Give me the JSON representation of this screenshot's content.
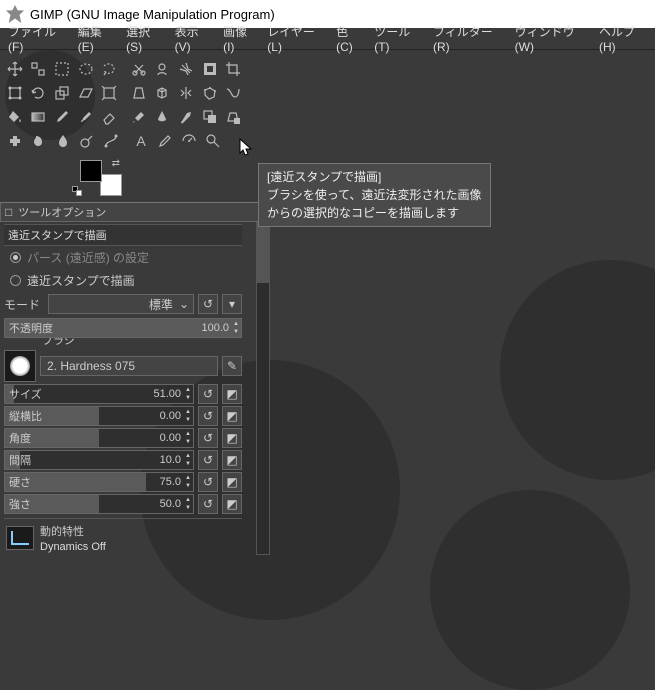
{
  "window": {
    "title": "GIMP (GNU Image Manipulation Program)"
  },
  "menu": {
    "file": "ファイル(F)",
    "edit": "編集(E)",
    "select": "選択(S)",
    "view": "表示(V)",
    "image": "画像(I)",
    "layer": "レイヤー(L)",
    "color": "色(C)",
    "tools": "ツール(T)",
    "filter": "フィルター(R)",
    "window": "ウィンドウ(W)",
    "help": "ヘルプ(H)"
  },
  "dock": {
    "title_icon": "□",
    "title": "ツールオプション",
    "menu_btn": "◂"
  },
  "options": {
    "title": "遠近スタンプで描画",
    "radio1": "パース (遠近感) の設定",
    "radio2": "遠近スタンプで描画",
    "mode_label": "モード",
    "mode_value": "標準",
    "opacity_label": "不透明度",
    "opacity_value": "100.0",
    "brush_label": "ブラシ",
    "brush_name": "2. Hardness 075",
    "size_label": "サイズ",
    "size_value": "51.00",
    "aspect_label": "縦横比",
    "aspect_value": "0.00",
    "angle_label": "角度",
    "angle_value": "0.00",
    "spacing_label": "間隔",
    "spacing_value": "10.0",
    "hardness_label": "硬さ",
    "hardness_value": "75.0",
    "force_label": "強さ",
    "force_value": "50.0",
    "dynamics_label": "動的特性",
    "dynamics_value": "Dynamics Off"
  },
  "tooltip": {
    "title": "[遠近スタンプで描画]",
    "line1": "ブラシを使って、遠近法変形された画像",
    "line2": "からの選択的なコピーを描画します"
  },
  "colors": {
    "fg": "#000000",
    "bg": "#ffffff"
  }
}
